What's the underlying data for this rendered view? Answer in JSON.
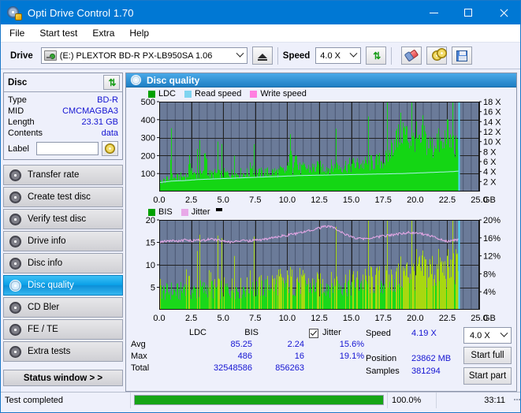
{
  "window": {
    "title": "Opti Drive Control 1.70",
    "icon": "disc-icon",
    "minimize_label": "−",
    "maximize_label": "□",
    "close_label": "✕"
  },
  "menu": {
    "items": [
      {
        "label": "File",
        "name": "menu-file"
      },
      {
        "label": "Start test",
        "name": "menu-start-test"
      },
      {
        "label": "Extra",
        "name": "menu-extra"
      },
      {
        "label": "Help",
        "name": "menu-help"
      }
    ]
  },
  "toolbar": {
    "drive_label": "Drive",
    "drive_value": "(E:)   PLEXTOR BD-R  PX-LB950SA 1.06",
    "eject_label": "eject",
    "speed_label": "Speed",
    "speed_value": "4.0 X",
    "refresh_label": "refresh",
    "erase_label": "erase",
    "disc_label": "disc",
    "save_label": "save"
  },
  "disc_panel": {
    "title": "Disc",
    "refresh_label": "refresh",
    "rows": [
      {
        "key": "Type",
        "value": "BD-R"
      },
      {
        "key": "MID",
        "value": "CMCMAGBA3"
      },
      {
        "key": "Length",
        "value": "23.31 GB"
      },
      {
        "key": "Contents",
        "value": "data"
      }
    ],
    "label_key": "Label",
    "label_value": "",
    "label_placeholder": ""
  },
  "sidebar": {
    "items": [
      {
        "label": "Transfer rate",
        "name": "sidebar-item-transfer-rate",
        "active": false
      },
      {
        "label": "Create test disc",
        "name": "sidebar-item-create-test-disc",
        "active": false
      },
      {
        "label": "Verify test disc",
        "name": "sidebar-item-verify-test-disc",
        "active": false
      },
      {
        "label": "Drive info",
        "name": "sidebar-item-drive-info",
        "active": false
      },
      {
        "label": "Disc info",
        "name": "sidebar-item-disc-info",
        "active": false
      },
      {
        "label": "Disc quality",
        "name": "sidebar-item-disc-quality",
        "active": true
      },
      {
        "label": "CD Bler",
        "name": "sidebar-item-cd-bler",
        "active": false
      },
      {
        "label": "FE / TE",
        "name": "sidebar-item-fe-te",
        "active": false
      },
      {
        "label": "Extra tests",
        "name": "sidebar-item-extra-tests",
        "active": false
      }
    ],
    "status_window_label": "Status window > >"
  },
  "content": {
    "title": "Disc quality"
  },
  "stats": {
    "col_headers": [
      "",
      "LDC",
      "BIS"
    ],
    "rows": [
      {
        "name": "Avg",
        "ldc": "85.25",
        "bis": "2.24"
      },
      {
        "name": "Max",
        "ldc": "486",
        "bis": "16"
      },
      {
        "name": "Total",
        "ldc": "32548586",
        "bis": "856263"
      }
    ],
    "jitter_label": "Jitter",
    "jitter_checked": true,
    "jitter_avg": "15.6%",
    "jitter_max": "19.1%",
    "speed_key": "Speed",
    "speed_value": "4.19 X",
    "position_key": "Position",
    "position_value": "23862 MB",
    "samples_key": "Samples",
    "samples_value": "381294",
    "speed_select": "4.0 X",
    "start_full_label": "Start full",
    "start_part_label": "Start part"
  },
  "statusbar": {
    "message": "Test completed",
    "percent_label": "100.0%",
    "percent_value": 100,
    "time": "33:11"
  },
  "colors": {
    "accent": "#0078d4",
    "plot_bg": "#6b7b99",
    "ldc_green": "#14d614",
    "bis_green": "#0ed60e",
    "jitter_pink": "#e8a8e8",
    "read_speed": "#7fd4f0",
    "write_speed": "#ff7fe0",
    "value_blue": "#1414d2",
    "progress_green": "#16a516"
  },
  "chart_data": [
    {
      "type": "area",
      "name": "ldc-chart",
      "title": "",
      "xlabel": "GB",
      "ylabel": "",
      "xlim": [
        0,
        25
      ],
      "xticks": [
        "0.0",
        "2.5",
        "5.0",
        "7.5",
        "10.0",
        "12.5",
        "15.0",
        "17.5",
        "20.0",
        "22.5",
        "25.0"
      ],
      "ylim": [
        0,
        500
      ],
      "yticks": [
        "100",
        "200",
        "300",
        "400",
        "500"
      ],
      "y2lim": [
        0,
        18
      ],
      "y2ticks": [
        "2 X",
        "4 X",
        "6 X",
        "8 X",
        "10 X",
        "12 X",
        "14 X",
        "16 X",
        "18 X"
      ],
      "grid": true,
      "legend": [
        {
          "label": "LDC",
          "color": "#00a000"
        },
        {
          "label": "Read speed",
          "color": "#7fd4f0"
        },
        {
          "label": "Write speed",
          "color": "#ff7fe0"
        }
      ],
      "data_end_gb": 23.4,
      "series": [
        {
          "name": "LDC",
          "type": "area",
          "color": "#14d614",
          "x": [
            0.0,
            0.2,
            0.4,
            0.6,
            0.8,
            0.9,
            1.0,
            1.2,
            1.4,
            1.6,
            1.8,
            2.0,
            2.2,
            2.4,
            2.6,
            2.8,
            3.0,
            3.2,
            3.4,
            3.6,
            3.8,
            4.0,
            4.2,
            4.4,
            4.6,
            4.8,
            5.0,
            5.2,
            5.4,
            5.6,
            5.8,
            6.0,
            6.2,
            6.4,
            6.6,
            6.8,
            7.0,
            7.2,
            7.4,
            7.6,
            7.8,
            8.0,
            8.2,
            8.4,
            8.6,
            8.8,
            9.0,
            9.2,
            9.4,
            9.6,
            9.8,
            10.0,
            10.2,
            10.4,
            10.6,
            10.8,
            11.0,
            11.2,
            11.4,
            11.6,
            11.8,
            12.0,
            12.2,
            12.4,
            12.6,
            12.8,
            13.0,
            13.2,
            13.4,
            13.6,
            13.8,
            14.0,
            14.2,
            14.4,
            14.6,
            14.8,
            15.0,
            15.2,
            15.4,
            15.6,
            15.8,
            16.0,
            16.2,
            16.4,
            16.6,
            16.8,
            17.0,
            17.2,
            17.4,
            17.6,
            17.8,
            18.0,
            18.2,
            18.4,
            18.6,
            18.8,
            19.0,
            19.2,
            19.4,
            19.6,
            19.8,
            20.0,
            20.2,
            20.4,
            20.6,
            20.8,
            21.0,
            21.2,
            21.4,
            21.6,
            21.8,
            22.0,
            22.2,
            22.4,
            22.6,
            22.8,
            23.0,
            23.2,
            23.4
          ],
          "values": [
            62,
            72,
            78,
            82,
            86,
            430,
            95,
            90,
            96,
            100,
            104,
            108,
            112,
            230,
            118,
            116,
            120,
            114,
            118,
            300,
            120,
            118,
            122,
            124,
            118,
            120,
            126,
            122,
            124,
            120,
            126,
            122,
            128,
            126,
            124,
            128,
            126,
            200,
            130,
            128,
            126,
            130,
            134,
            132,
            130,
            136,
            138,
            134,
            140,
            142,
            138,
            144,
            340,
            150,
            348,
            160,
            158,
            156,
            162,
            160,
            158,
            164,
            162,
            166,
            164,
            168,
            170,
            166,
            172,
            168,
            174,
            178,
            176,
            180,
            182,
            178,
            184,
            188,
            186,
            190,
            192,
            188,
            194,
            196,
            198,
            200,
            204,
            210,
            215,
            220,
            230,
            280,
            320,
            390,
            350,
            420,
            430,
            400,
            380,
            360,
            340,
            400,
            330,
            310,
            430,
            350,
            330,
            320,
            300,
            380,
            340,
            320,
            300,
            460,
            350,
            330,
            310,
            300,
            290
          ]
        },
        {
          "name": "Read speed",
          "type": "line",
          "color": "#a8f0e8",
          "x": [
            0.0,
            1.0,
            2.0,
            3.0,
            4.0,
            5.0,
            6.0,
            7.0,
            8.0,
            9.0,
            10.0,
            11.0,
            12.0,
            13.0,
            14.0,
            15.0,
            16.0,
            17.0,
            18.0,
            19.0,
            20.0,
            21.0,
            22.0,
            23.0,
            23.4
          ],
          "values": [
            1.8,
            2.1,
            2.2,
            2.4,
            2.5,
            2.6,
            2.7,
            2.8,
            2.9,
            3.0,
            3.1,
            3.2,
            3.25,
            3.3,
            3.35,
            3.4,
            3.45,
            3.5,
            3.55,
            3.6,
            3.7,
            3.8,
            3.9,
            4.0,
            4.1
          ]
        }
      ]
    },
    {
      "type": "area",
      "name": "bis-jitter-chart",
      "title": "",
      "xlabel": "GB",
      "ylabel": "",
      "xlim": [
        0,
        25
      ],
      "xticks": [
        "0.0",
        "2.5",
        "5.0",
        "7.5",
        "10.0",
        "12.5",
        "15.0",
        "17.5",
        "20.0",
        "22.5",
        "25.0"
      ],
      "ylim": [
        0,
        20
      ],
      "yticks": [
        "5",
        "10",
        "15",
        "20"
      ],
      "y2lim": [
        0,
        20
      ],
      "y2ticks": [
        "4%",
        "8%",
        "12%",
        "16%",
        "20%"
      ],
      "grid": true,
      "legend": [
        {
          "label": "BIS",
          "color": "#00a000"
        },
        {
          "label": "Jitter",
          "color": "#e8a8e8"
        }
      ],
      "data_end_gb": 23.4,
      "series": [
        {
          "name": "BIS",
          "type": "area",
          "color": "#7ad60e",
          "x": [
            0.0,
            0.3,
            0.6,
            0.9,
            1.2,
            1.5,
            1.8,
            2.1,
            2.4,
            2.7,
            3.0,
            3.3,
            3.6,
            3.9,
            4.2,
            4.5,
            4.8,
            5.1,
            5.4,
            5.7,
            6.0,
            6.3,
            6.6,
            6.9,
            7.2,
            7.5,
            7.8,
            8.1,
            8.4,
            8.7,
            9.0,
            9.3,
            9.6,
            9.9,
            10.2,
            10.5,
            10.8,
            11.1,
            11.4,
            11.7,
            12.0,
            12.3,
            12.6,
            12.9,
            13.2,
            13.5,
            13.8,
            14.1,
            14.4,
            14.7,
            15.0,
            15.3,
            15.6,
            15.9,
            16.2,
            16.5,
            16.8,
            17.1,
            17.4,
            17.7,
            18.0,
            18.3,
            18.6,
            18.9,
            19.2,
            19.5,
            19.8,
            20.1,
            20.4,
            20.7,
            21.0,
            21.3,
            21.6,
            21.9,
            22.2,
            22.5,
            22.8,
            23.1,
            23.4
          ],
          "values": [
            8.0,
            6.2,
            6.0,
            6.5,
            6.2,
            6.0,
            6.4,
            11.2,
            6.8,
            6.4,
            6.6,
            7.0,
            6.8,
            9.8,
            7.2,
            7.0,
            7.4,
            7.2,
            7.0,
            7.6,
            7.4,
            7.2,
            7.8,
            7.6,
            9.8,
            7.4,
            7.8,
            8.0,
            7.6,
            10.0,
            8.2,
            10.6,
            8.0,
            9.0,
            10.4,
            8.6,
            10.8,
            8.8,
            9.2,
            8.4,
            8.0,
            8.6,
            8.2,
            8.8,
            9.0,
            8.4,
            9.2,
            8.6,
            9.4,
            9.0,
            8.8,
            9.6,
            9.2,
            9.8,
            9.4,
            10.0,
            9.6,
            10.2,
            9.8,
            10.4,
            10.0,
            11.0,
            10.6,
            12.4,
            11.8,
            13.4,
            12.0,
            13.8,
            12.6,
            14.2,
            13.0,
            13.6,
            12.8,
            14.4,
            13.2,
            13.8,
            13.0,
            14.0,
            13.5
          ]
        },
        {
          "name": "Jitter",
          "type": "line",
          "color": "#e8a8e8",
          "x": [
            0.0,
            0.5,
            1.0,
            1.5,
            2.0,
            2.5,
            3.0,
            3.5,
            4.0,
            4.5,
            5.0,
            5.5,
            6.0,
            6.5,
            7.0,
            7.5,
            8.0,
            8.5,
            9.0,
            9.5,
            10.0,
            10.5,
            11.0,
            11.5,
            12.0,
            12.5,
            13.0,
            13.5,
            14.0,
            14.5,
            15.0,
            15.5,
            16.0,
            16.5,
            17.0,
            17.5,
            18.0,
            18.5,
            19.0,
            19.5,
            20.0,
            20.5,
            21.0,
            21.5,
            22.0,
            22.5,
            23.0,
            23.4
          ],
          "values": [
            15.0,
            15.3,
            15.4,
            15.2,
            15.5,
            15.3,
            15.6,
            15.4,
            15.8,
            15.5,
            15.3,
            15.1,
            15.2,
            15.4,
            15.3,
            15.5,
            15.6,
            15.8,
            16.1,
            16.4,
            16.6,
            16.8,
            17.1,
            17.4,
            17.8,
            18.2,
            18.6,
            18.4,
            17.6,
            16.8,
            16.2,
            15.9,
            15.8,
            16.0,
            16.2,
            16.4,
            16.6,
            16.8,
            17.0,
            17.2,
            17.1,
            16.9,
            16.6,
            16.2,
            15.6,
            15.2,
            15.4,
            15.6
          ]
        }
      ]
    }
  ]
}
